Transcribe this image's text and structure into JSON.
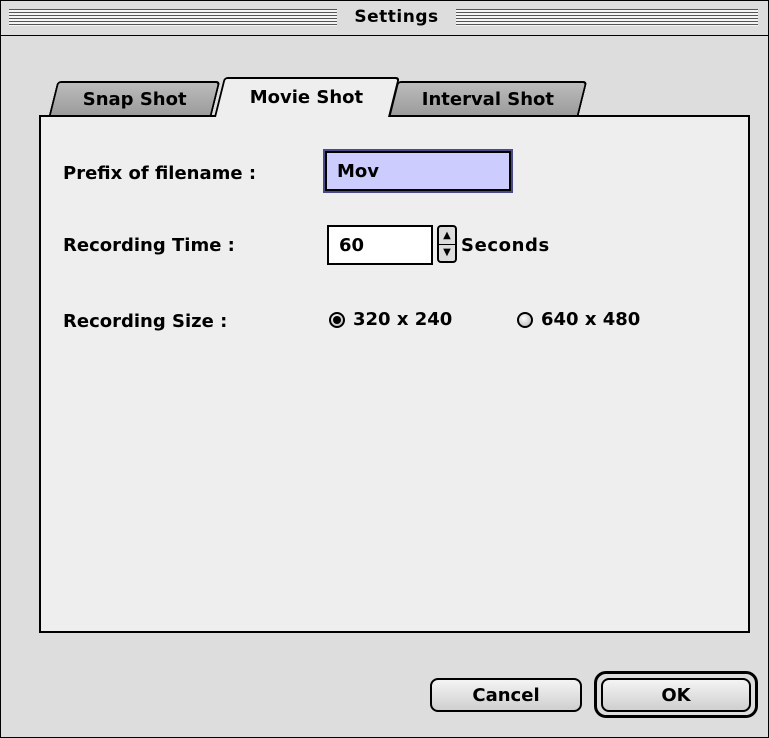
{
  "window": {
    "title": "Settings"
  },
  "tabs": [
    {
      "label": "Snap Shot",
      "selected": false
    },
    {
      "label": "Movie Shot",
      "selected": true
    },
    {
      "label": "Interval Shot",
      "selected": false
    }
  ],
  "form": {
    "prefix_label": "Prefix of filename :",
    "prefix_value": "Mov",
    "recording_time_label": "Recording Time :",
    "recording_time_value": "60",
    "recording_time_unit": "Seconds",
    "recording_size_label": "Recording Size :",
    "size_options": [
      {
        "label": "320 x 240",
        "selected": true
      },
      {
        "label": "640 x 480",
        "selected": false
      }
    ]
  },
  "buttons": {
    "cancel": "Cancel",
    "ok": "OK"
  },
  "icons": {
    "stepper": "up-down-arrows-icon",
    "radio": "radio-button-icon"
  },
  "colors": {
    "window_bg": "#dddddd",
    "panel_bg": "#eeeeee",
    "focused_field_bg": "#ccccff"
  }
}
